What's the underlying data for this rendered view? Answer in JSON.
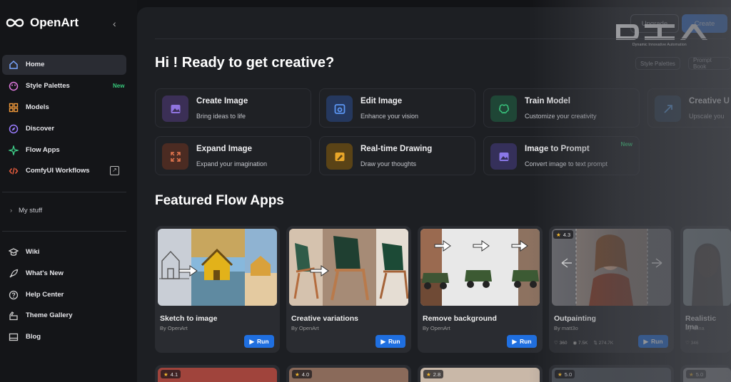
{
  "app": {
    "name": "OpenArt"
  },
  "sidebar": {
    "items": [
      {
        "label": "Home",
        "icon": "home-icon"
      },
      {
        "label": "Style Palettes",
        "icon": "palette-icon",
        "badge": "New"
      },
      {
        "label": "Models",
        "icon": "grid-icon"
      },
      {
        "label": "Discover",
        "icon": "compass-icon"
      },
      {
        "label": "Flow Apps",
        "icon": "sparkle-icon"
      },
      {
        "label": "ComfyUI Workflows",
        "icon": "code-icon"
      }
    ],
    "my_stuff": "My stuff",
    "footer_items": [
      {
        "label": "Wiki",
        "icon": "graduation-cap-icon"
      },
      {
        "label": "What's New",
        "icon": "rocket-icon"
      },
      {
        "label": "Help Center",
        "icon": "question-icon"
      },
      {
        "label": "Theme Gallery",
        "icon": "brush-icon"
      },
      {
        "label": "Blog",
        "icon": "blog-icon"
      }
    ]
  },
  "header": {
    "upgrade": "Upgrade",
    "create": "Create",
    "watermark": "DIA",
    "watermark_sub": "Dynamic Innovative Automation"
  },
  "main": {
    "greeting": "Hi ! Ready to get creative?",
    "chips": [
      "Style Palettes",
      "Prompt Book"
    ],
    "tools": [
      {
        "title": "Create Image",
        "subtitle": "Bring ideas to life",
        "color": "#3b2f56"
      },
      {
        "title": "Edit Image",
        "subtitle": "Enhance your vision",
        "color": "#25385e"
      },
      {
        "title": "Train Model",
        "subtitle": "Customize your creativity",
        "color": "#1f4636"
      },
      {
        "title": "Creative U",
        "subtitle": "Upscale you",
        "color": "#26384c"
      },
      {
        "title": "Expand Image",
        "subtitle": "Expand your imagination",
        "color": "#4b2b22"
      },
      {
        "title": "Real-time Drawing",
        "subtitle": "Draw your thoughts",
        "color": "#5a4316"
      },
      {
        "title": "Image to Prompt",
        "subtitle": "Convert image to text prompt",
        "color": "#35305a",
        "badge": "New"
      }
    ],
    "section_title": "Featured Flow Apps",
    "flow_apps": [
      {
        "title": "Sketch to image",
        "by": "By OpenArt",
        "run": "Run"
      },
      {
        "title": "Creative variations",
        "by": "By OpenArt",
        "run": "Run"
      },
      {
        "title": "Remove background",
        "by": "By OpenArt",
        "run": "Run"
      },
      {
        "title": "Outpainting",
        "by": "By matt3o",
        "run": "Run",
        "rating": "4.3",
        "stats": [
          "360",
          "7.5K",
          "274.7K"
        ]
      },
      {
        "title": "Realistic Ima",
        "by": "By Gina",
        "rating": "",
        "stats": [
          "346"
        ]
      }
    ],
    "bottom_ratings": [
      "4.1",
      "4.0",
      "2.8",
      "5.0",
      "5.0"
    ]
  }
}
